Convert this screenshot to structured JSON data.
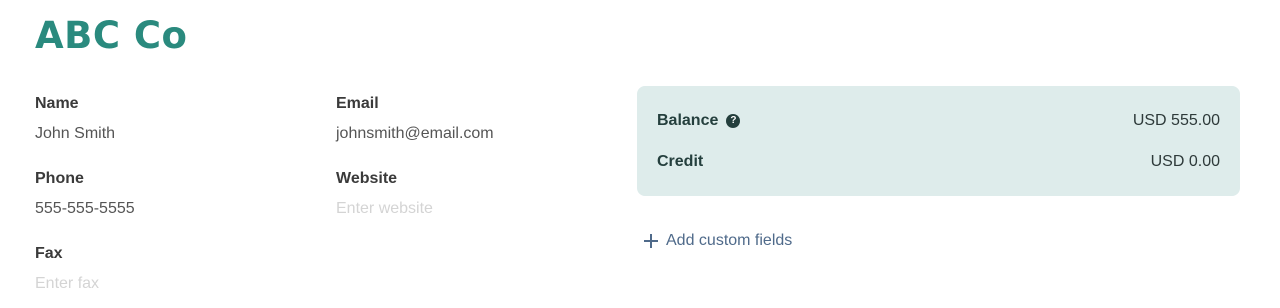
{
  "company": {
    "name": "ABC Co"
  },
  "contact": {
    "name_label": "Name",
    "name_value": "John Smith",
    "phone_label": "Phone",
    "phone_value": "555-555-5555",
    "fax_label": "Fax",
    "fax_placeholder": "Enter fax",
    "email_label": "Email",
    "email_value": "johnsmith@email.com",
    "website_label": "Website",
    "website_placeholder": "Enter website"
  },
  "balance_card": {
    "balance_label": "Balance",
    "balance_help_icon": "?",
    "balance_amount": "USD 555.00",
    "credit_label": "Credit",
    "credit_amount": "USD 0.00"
  },
  "actions": {
    "add_custom_fields_label": "Add custom fields"
  },
  "colors": {
    "title": "#2a8a7e",
    "card_background": "#deeceb",
    "link": "#4f6a8a"
  }
}
